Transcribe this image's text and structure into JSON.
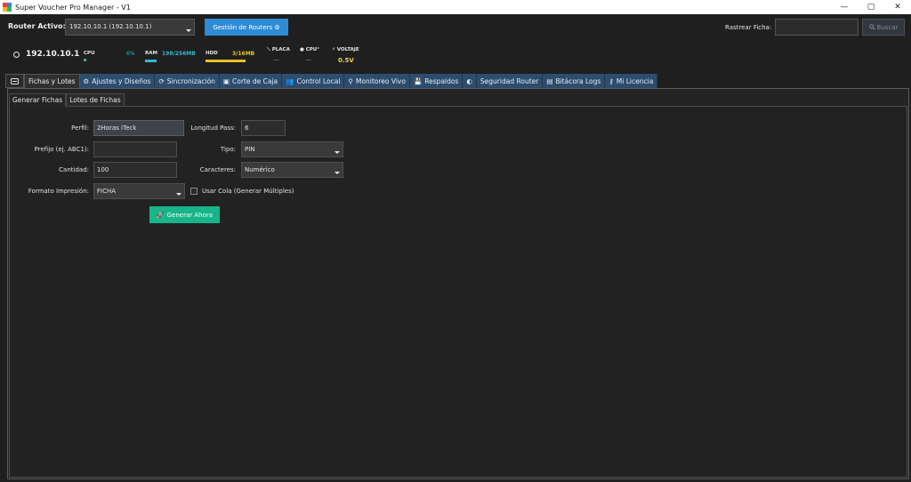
{
  "window": {
    "title": "Super Voucher Pro Manager - V1",
    "minimize_glyph": "—",
    "maximize_glyph": "▢",
    "close_glyph": "✕"
  },
  "router": {
    "label": "Router Activo:",
    "selected": "192.10.10.1 (192.10.10.1)",
    "manage_button": "Gestión de Routers ⚙"
  },
  "search": {
    "label": "Rastrear Ficha:",
    "value": "",
    "button": "Buscar"
  },
  "stats": {
    "ip": "192.10.10.1",
    "cpu_label": "CPU",
    "cpu_value": "6%",
    "cpu_level": 0.06,
    "ram_label": "RAM",
    "ram_value": "198/256MB",
    "ram_level": 0.77,
    "hdd_label": "HDD",
    "hdd_value": "3/16MB",
    "hdd_level": 1.0,
    "placa_label": "PLACA",
    "placa_value": "—",
    "cpu_temp_label": "CPU°",
    "cpu_temp_value": "—",
    "voltaje_label": "VOLTAJE",
    "voltaje_value": "0.5V",
    "colors": {
      "cpu": "#1fbf8f",
      "ram": "#2fb8d0",
      "hdd": "#e6c229",
      "voltaje": "#f0d24a"
    }
  },
  "tabs": [
    {
      "label": "Fichas y Lotes",
      "icon": "ticket-icon"
    },
    {
      "label": "Ajustes y Diseños",
      "icon": "gear-icon"
    },
    {
      "label": "Sincronización",
      "icon": "sync-icon"
    },
    {
      "label": "Corte de Caja",
      "icon": "cash-register-icon"
    },
    {
      "label": "Control Local",
      "icon": "users-icon"
    },
    {
      "label": "Monitoreo Vivo",
      "icon": "pulse-icon"
    },
    {
      "label": "Respaldos",
      "icon": "save-icon"
    },
    {
      "label": "",
      "icon": "contrast-icon"
    },
    {
      "label": "Seguridad Router",
      "icon": ""
    },
    {
      "label": "Bitácora Logs",
      "icon": "document-icon"
    },
    {
      "label": "Mi Licencia",
      "icon": "key-icon"
    }
  ],
  "subtabs": [
    "Generar Fichas",
    "Lotes de Fichas"
  ],
  "form": {
    "perfil_label": "Perfil:",
    "perfil_value": "2Horas iTeck",
    "longitud_label": "Longitud Pass:",
    "longitud_value": "6",
    "prefijo_label": "Prefijo (ej. ABC1):",
    "prefijo_value": "",
    "tipo_label": "Tipo:",
    "tipo_value": "PIN",
    "cantidad_label": "Cantidad:",
    "cantidad_value": "100",
    "caracteres_label": "Caracteres:",
    "caracteres_value": "Numérico",
    "formato_label": "Formato Impresión:",
    "formato_value": "FICHA",
    "cola_label": "Usar Cola (Generar Múltiples)",
    "generate_button": "Generar Ahora"
  }
}
